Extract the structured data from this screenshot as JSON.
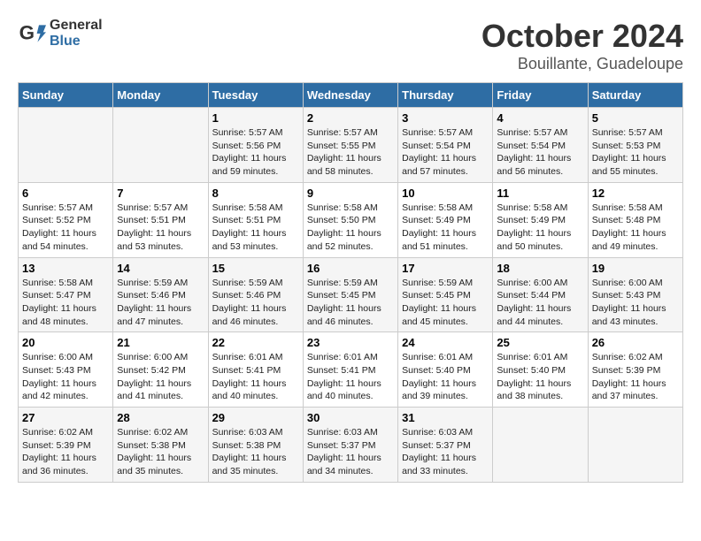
{
  "logo": {
    "text_general": "General",
    "text_blue": "Blue"
  },
  "title": "October 2024",
  "subtitle": "Bouillante, Guadeloupe",
  "days_header": [
    "Sunday",
    "Monday",
    "Tuesday",
    "Wednesday",
    "Thursday",
    "Friday",
    "Saturday"
  ],
  "weeks": [
    [
      {
        "day": "",
        "sunrise": "",
        "sunset": "",
        "daylight": ""
      },
      {
        "day": "",
        "sunrise": "",
        "sunset": "",
        "daylight": ""
      },
      {
        "day": "1",
        "sunrise": "Sunrise: 5:57 AM",
        "sunset": "Sunset: 5:56 PM",
        "daylight": "Daylight: 11 hours and 59 minutes."
      },
      {
        "day": "2",
        "sunrise": "Sunrise: 5:57 AM",
        "sunset": "Sunset: 5:55 PM",
        "daylight": "Daylight: 11 hours and 58 minutes."
      },
      {
        "day": "3",
        "sunrise": "Sunrise: 5:57 AM",
        "sunset": "Sunset: 5:54 PM",
        "daylight": "Daylight: 11 hours and 57 minutes."
      },
      {
        "day": "4",
        "sunrise": "Sunrise: 5:57 AM",
        "sunset": "Sunset: 5:54 PM",
        "daylight": "Daylight: 11 hours and 56 minutes."
      },
      {
        "day": "5",
        "sunrise": "Sunrise: 5:57 AM",
        "sunset": "Sunset: 5:53 PM",
        "daylight": "Daylight: 11 hours and 55 minutes."
      }
    ],
    [
      {
        "day": "6",
        "sunrise": "Sunrise: 5:57 AM",
        "sunset": "Sunset: 5:52 PM",
        "daylight": "Daylight: 11 hours and 54 minutes."
      },
      {
        "day": "7",
        "sunrise": "Sunrise: 5:57 AM",
        "sunset": "Sunset: 5:51 PM",
        "daylight": "Daylight: 11 hours and 53 minutes."
      },
      {
        "day": "8",
        "sunrise": "Sunrise: 5:58 AM",
        "sunset": "Sunset: 5:51 PM",
        "daylight": "Daylight: 11 hours and 53 minutes."
      },
      {
        "day": "9",
        "sunrise": "Sunrise: 5:58 AM",
        "sunset": "Sunset: 5:50 PM",
        "daylight": "Daylight: 11 hours and 52 minutes."
      },
      {
        "day": "10",
        "sunrise": "Sunrise: 5:58 AM",
        "sunset": "Sunset: 5:49 PM",
        "daylight": "Daylight: 11 hours and 51 minutes."
      },
      {
        "day": "11",
        "sunrise": "Sunrise: 5:58 AM",
        "sunset": "Sunset: 5:49 PM",
        "daylight": "Daylight: 11 hours and 50 minutes."
      },
      {
        "day": "12",
        "sunrise": "Sunrise: 5:58 AM",
        "sunset": "Sunset: 5:48 PM",
        "daylight": "Daylight: 11 hours and 49 minutes."
      }
    ],
    [
      {
        "day": "13",
        "sunrise": "Sunrise: 5:58 AM",
        "sunset": "Sunset: 5:47 PM",
        "daylight": "Daylight: 11 hours and 48 minutes."
      },
      {
        "day": "14",
        "sunrise": "Sunrise: 5:59 AM",
        "sunset": "Sunset: 5:46 PM",
        "daylight": "Daylight: 11 hours and 47 minutes."
      },
      {
        "day": "15",
        "sunrise": "Sunrise: 5:59 AM",
        "sunset": "Sunset: 5:46 PM",
        "daylight": "Daylight: 11 hours and 46 minutes."
      },
      {
        "day": "16",
        "sunrise": "Sunrise: 5:59 AM",
        "sunset": "Sunset: 5:45 PM",
        "daylight": "Daylight: 11 hours and 46 minutes."
      },
      {
        "day": "17",
        "sunrise": "Sunrise: 5:59 AM",
        "sunset": "Sunset: 5:45 PM",
        "daylight": "Daylight: 11 hours and 45 minutes."
      },
      {
        "day": "18",
        "sunrise": "Sunrise: 6:00 AM",
        "sunset": "Sunset: 5:44 PM",
        "daylight": "Daylight: 11 hours and 44 minutes."
      },
      {
        "day": "19",
        "sunrise": "Sunrise: 6:00 AM",
        "sunset": "Sunset: 5:43 PM",
        "daylight": "Daylight: 11 hours and 43 minutes."
      }
    ],
    [
      {
        "day": "20",
        "sunrise": "Sunrise: 6:00 AM",
        "sunset": "Sunset: 5:43 PM",
        "daylight": "Daylight: 11 hours and 42 minutes."
      },
      {
        "day": "21",
        "sunrise": "Sunrise: 6:00 AM",
        "sunset": "Sunset: 5:42 PM",
        "daylight": "Daylight: 11 hours and 41 minutes."
      },
      {
        "day": "22",
        "sunrise": "Sunrise: 6:01 AM",
        "sunset": "Sunset: 5:41 PM",
        "daylight": "Daylight: 11 hours and 40 minutes."
      },
      {
        "day": "23",
        "sunrise": "Sunrise: 6:01 AM",
        "sunset": "Sunset: 5:41 PM",
        "daylight": "Daylight: 11 hours and 40 minutes."
      },
      {
        "day": "24",
        "sunrise": "Sunrise: 6:01 AM",
        "sunset": "Sunset: 5:40 PM",
        "daylight": "Daylight: 11 hours and 39 minutes."
      },
      {
        "day": "25",
        "sunrise": "Sunrise: 6:01 AM",
        "sunset": "Sunset: 5:40 PM",
        "daylight": "Daylight: 11 hours and 38 minutes."
      },
      {
        "day": "26",
        "sunrise": "Sunrise: 6:02 AM",
        "sunset": "Sunset: 5:39 PM",
        "daylight": "Daylight: 11 hours and 37 minutes."
      }
    ],
    [
      {
        "day": "27",
        "sunrise": "Sunrise: 6:02 AM",
        "sunset": "Sunset: 5:39 PM",
        "daylight": "Daylight: 11 hours and 36 minutes."
      },
      {
        "day": "28",
        "sunrise": "Sunrise: 6:02 AM",
        "sunset": "Sunset: 5:38 PM",
        "daylight": "Daylight: 11 hours and 35 minutes."
      },
      {
        "day": "29",
        "sunrise": "Sunrise: 6:03 AM",
        "sunset": "Sunset: 5:38 PM",
        "daylight": "Daylight: 11 hours and 35 minutes."
      },
      {
        "day": "30",
        "sunrise": "Sunrise: 6:03 AM",
        "sunset": "Sunset: 5:37 PM",
        "daylight": "Daylight: 11 hours and 34 minutes."
      },
      {
        "day": "31",
        "sunrise": "Sunrise: 6:03 AM",
        "sunset": "Sunset: 5:37 PM",
        "daylight": "Daylight: 11 hours and 33 minutes."
      },
      {
        "day": "",
        "sunrise": "",
        "sunset": "",
        "daylight": ""
      },
      {
        "day": "",
        "sunrise": "",
        "sunset": "",
        "daylight": ""
      }
    ]
  ]
}
